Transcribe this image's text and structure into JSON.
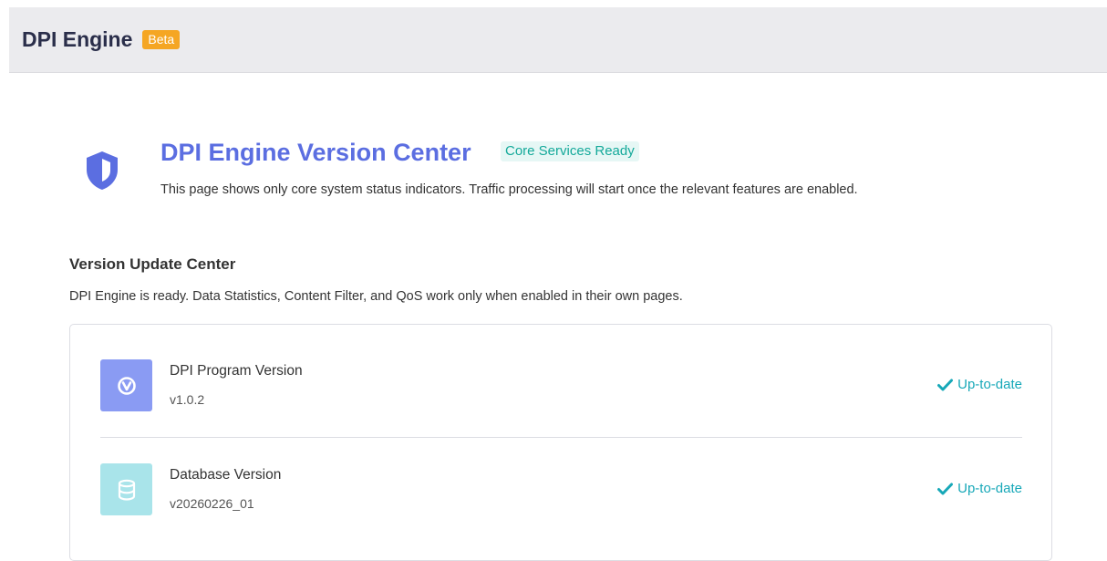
{
  "header": {
    "title": "DPI Engine",
    "badge": "Beta"
  },
  "hero": {
    "icon": "shield-icon",
    "title": "DPI Engine Version Center",
    "status_badge": "Core Services Ready",
    "description": "This page shows only core system status indicators. Traffic processing will start once the relevant features are enabled."
  },
  "section": {
    "title": "Version Update Center",
    "description": "DPI Engine is ready. Data Statistics, Content Filter, and QoS work only when enabled in their own pages."
  },
  "items": [
    {
      "icon": "program-version-icon",
      "name": "DPI Program Version",
      "version": "v1.0.2",
      "status": "Up-to-date"
    },
    {
      "icon": "database-icon",
      "name": "Database Version",
      "version": "v20260226_01",
      "status": "Up-to-date"
    }
  ],
  "colors": {
    "accent": "#5b6ee1",
    "beta": "#f5a623",
    "ready": "#14a99a",
    "status": "#17a8b8",
    "program_icon_bg": "#8a9bf3",
    "db_icon_bg": "#a9e4ea"
  }
}
